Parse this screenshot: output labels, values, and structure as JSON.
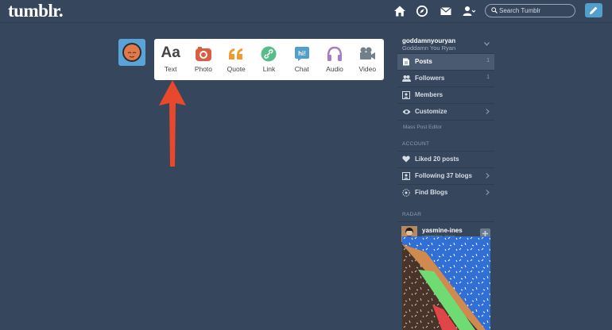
{
  "header": {
    "logo": "tumblr.",
    "search_placeholder": "Search Tumblr",
    "icons": [
      "home-icon",
      "explore-compass-icon",
      "inbox-icon",
      "account-icon",
      "compose-pencil-icon"
    ]
  },
  "post_types": [
    {
      "label": "Text",
      "icon": "text-aa-icon",
      "color": "#444444"
    },
    {
      "label": "Photo",
      "icon": "camera-icon",
      "color": "#d95e40"
    },
    {
      "label": "Quote",
      "icon": "quote-icon",
      "color": "#f2992e"
    },
    {
      "label": "Link",
      "icon": "link-icon",
      "color": "#56bc8a"
    },
    {
      "label": "Chat",
      "icon": "chat-icon",
      "color": "#529ecc"
    },
    {
      "label": "Audio",
      "icon": "headphones-icon",
      "color": "#a77dc2"
    },
    {
      "label": "Video",
      "icon": "video-camera-icon",
      "color": "#748089"
    }
  ],
  "text_icon_glyph": "Aa",
  "sidebar": {
    "blog_name": "goddamnyouryan",
    "blog_title": "Goddamn You Ryan",
    "items": [
      {
        "label": "Posts",
        "count": "1",
        "icon": "posts-icon"
      },
      {
        "label": "Followers",
        "count": "1",
        "icon": "followers-icon"
      },
      {
        "label": "Members",
        "count": "",
        "icon": "members-icon"
      },
      {
        "label": "Customize",
        "count": "",
        "icon": "eye-icon"
      }
    ],
    "mass_post_editor": "Mass Post Editor",
    "account_title": "ACCOUNT",
    "account_items": [
      {
        "label": "Liked 20 posts",
        "icon": "heart-icon"
      },
      {
        "label": "Following 37 blogs",
        "icon": "following-icon"
      },
      {
        "label": "Find Blogs",
        "icon": "find-blogs-icon"
      }
    ],
    "radar_title": "RADAR",
    "radar": {
      "username": "yasmine-ines",
      "subtitle": "yasmine-ines"
    }
  },
  "colors": {
    "background": "#36465d",
    "accent": "#529ecc",
    "arrow": "#e8482b"
  }
}
